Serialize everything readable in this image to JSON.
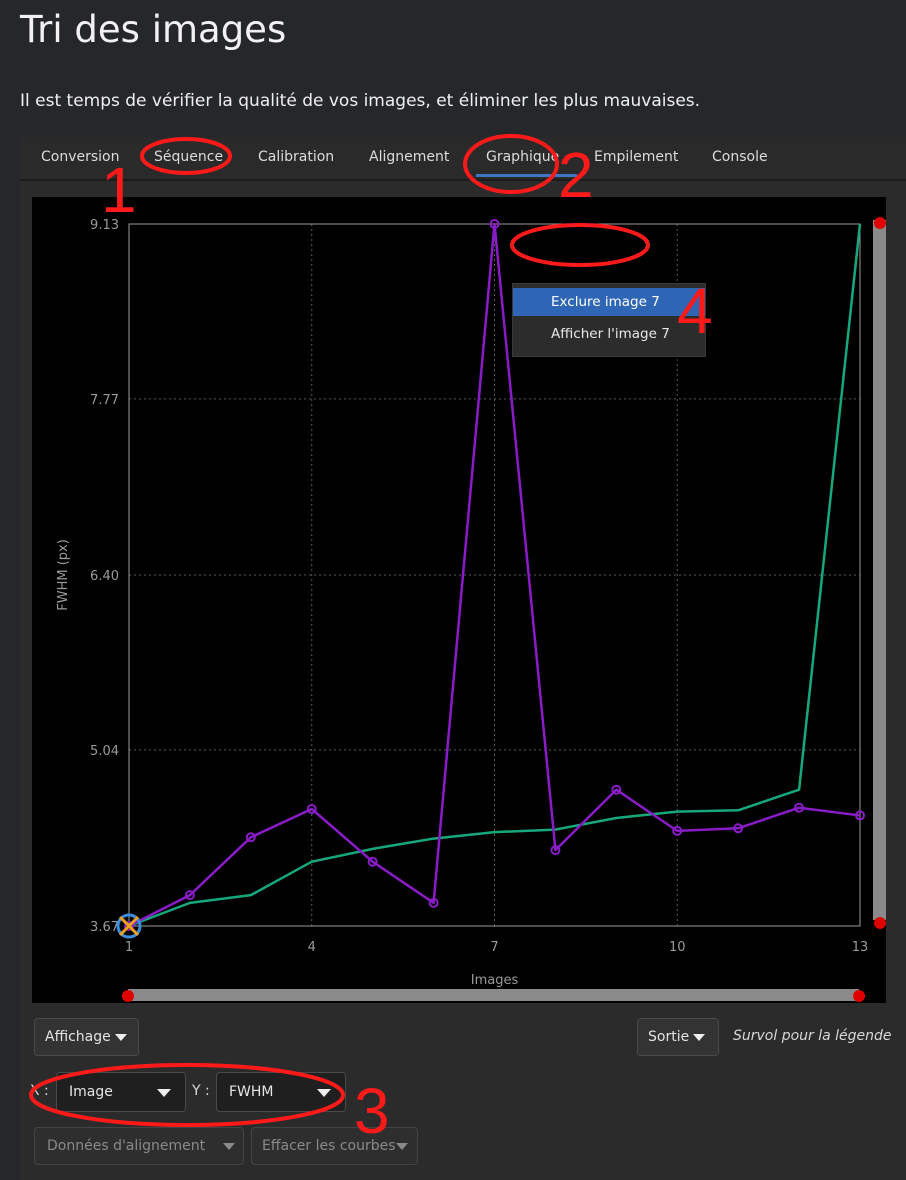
{
  "page": {
    "title": "Tri des images",
    "intro": "Il est temps de vérifier la qualité de vos images, et éliminer les plus mauvaises."
  },
  "tabs": [
    {
      "label": "Conversion"
    },
    {
      "label": "Séquence"
    },
    {
      "label": "Calibration"
    },
    {
      "label": "Alignement"
    },
    {
      "label": "Graphique",
      "active": true
    },
    {
      "label": "Empilement"
    },
    {
      "label": "Console"
    }
  ],
  "context_menu": {
    "items": [
      {
        "label": "Exclure image 7",
        "highlighted": true
      },
      {
        "label": "Afficher l'image 7"
      }
    ]
  },
  "controls": {
    "display_button": "Affichage",
    "output_button": "Sortie",
    "legend_hint": "Survol pour la légende",
    "x_label": "X :",
    "x_value": "Image",
    "y_label": "Y :",
    "y_value": "FWHM",
    "align_data_button": "Données d'alignement",
    "clear_curves_button": "Effacer les courbes"
  },
  "annotations": [
    "1",
    "2",
    "3",
    "4"
  ],
  "colors": {
    "series_purple": "#8a1cc8",
    "series_green": "#16a87c",
    "tab_underline": "#3f74c6",
    "annotation_red": "#ff1a1a",
    "menu_highlight": "#2f65b5"
  },
  "chart_data": {
    "type": "line",
    "xlabel": "Images",
    "ylabel": "FWHM (px)",
    "xlim": [
      1,
      13
    ],
    "ylim": [
      3.67,
      9.13
    ],
    "x_ticks": [
      "1",
      "4",
      "7",
      "10",
      "13"
    ],
    "y_ticks": [
      "3.67",
      "5.04",
      "6.40",
      "7.77",
      "9.13"
    ],
    "grid": true,
    "x": [
      1,
      2,
      3,
      4,
      5,
      6,
      7,
      8,
      9,
      10,
      11,
      12,
      13
    ],
    "series": [
      {
        "color": "#8a1cc8",
        "markers": true,
        "values": [
          3.67,
          3.91,
          4.36,
          4.58,
          4.17,
          3.85,
          9.13,
          4.26,
          4.73,
          4.41,
          4.43,
          4.59,
          4.53
        ]
      },
      {
        "color": "#16a87c",
        "markers": false,
        "values": [
          3.67,
          3.85,
          3.91,
          4.17,
          4.27,
          4.35,
          4.4,
          4.42,
          4.51,
          4.56,
          4.57,
          4.73,
          9.13
        ]
      }
    ]
  }
}
